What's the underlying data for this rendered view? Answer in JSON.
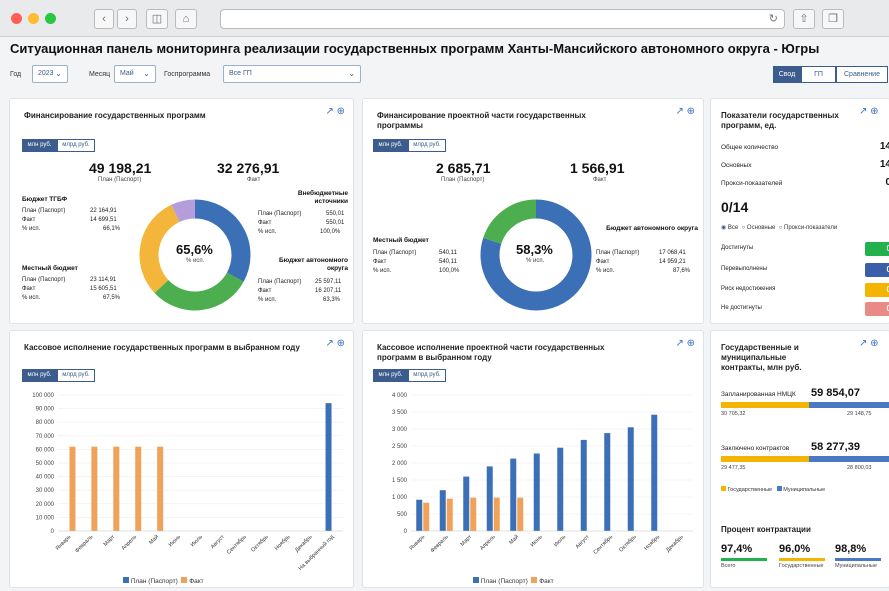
{
  "header": {
    "title": "Ситуационная панель мониторинга реализации государственных программ Ханты-Мансийского автономного округа - Югры"
  },
  "filters": {
    "year_label": "Год",
    "year_value": "2023",
    "month_label": "Месяц",
    "month_value": "Май",
    "program_label": "Госпрограмма",
    "program_value": "Все ГП"
  },
  "view_tabs": [
    "Свод",
    "ГП",
    "Сравнение"
  ],
  "unit_tabs": {
    "mln": "млн руб.",
    "mlrd": "млрд руб."
  },
  "financing": {
    "title": "Финансирование государственных программ",
    "plan_value": "49 198,21",
    "plan_label": "План (Паспорт)",
    "fact_value": "32 276,91",
    "fact_label": "Факт",
    "center_pct": "65,6%",
    "center_sub": "% исп.",
    "blocks": {
      "tgbf": {
        "name": "Бюджет ТГБФ",
        "rows": [
          [
            "План (Паспорт)",
            "22 164,91"
          ],
          [
            "Факт",
            "14 699,51"
          ],
          [
            "% исп.",
            "66,1%"
          ]
        ]
      },
      "local": {
        "name": "Местный бюджет",
        "rows": [
          [
            "План (Паспорт)",
            "23 114,91"
          ],
          [
            "Факт",
            "15 605,51"
          ],
          [
            "% исп.",
            "67,5%"
          ]
        ]
      },
      "offbudget": {
        "name": "Внебюджетные источники",
        "rows": [
          [
            "План (Паспорт)",
            "550,01"
          ],
          [
            "Факт",
            "550,01"
          ],
          [
            "% исп.",
            "100,0%"
          ]
        ]
      },
      "okrug": {
        "name": "Бюджет автономного округа",
        "rows": [
          [
            "План (Паспорт)",
            "25 597,11"
          ],
          [
            "Факт",
            "16 207,11"
          ],
          [
            "% исп.",
            "63,3%"
          ]
        ]
      }
    },
    "donut": [
      {
        "pct": 33.0,
        "color": "#3b6fb6"
      },
      {
        "pct": 30.0,
        "color": "#4cae4f"
      },
      {
        "pct": 30.0,
        "color": "#f3b63a"
      },
      {
        "pct": 7.0,
        "color": "#b39ddb"
      }
    ]
  },
  "project_financing": {
    "title": "Финансирование проектной части государственных программы",
    "plan_value": "2 685,71",
    "plan_label": "План (Паспорт)",
    "fact_value": "1 566,91",
    "fact_label": "Факт",
    "center_pct": "58,3%",
    "center_sub": "% исп.",
    "blocks": {
      "local": {
        "name": "Местный бюджет",
        "rows": [
          [
            "План (Паспорт)",
            "540,11"
          ],
          [
            "Факт",
            "540,11"
          ],
          [
            "% исп.",
            "100,0%"
          ]
        ]
      },
      "okrug": {
        "name": "Бюджет автономного округа",
        "rows": [
          [
            "План (Паспорт)",
            "17 068,41"
          ],
          [
            "Факт",
            "14 959,21"
          ],
          [
            "% исп.",
            "87,6%"
          ]
        ]
      }
    },
    "donut": [
      {
        "pct": 80.0,
        "color": "#3b6fb6"
      },
      {
        "pct": 20.0,
        "color": "#4cae4f"
      }
    ]
  },
  "indicators": {
    "title": "Показатели государственных программ, ед.",
    "rows": [
      [
        "Общее количество",
        "14"
      ],
      [
        "Основных",
        "14"
      ],
      [
        "Прокси-показателей",
        "0"
      ]
    ],
    "ratio": "0/14",
    "radios": [
      "Все",
      "Основные",
      "Прокси-показатели"
    ],
    "statuses": [
      {
        "label": "Достигнуты",
        "value": "0",
        "color": "#22b14c"
      },
      {
        "label": "Перевыполнены",
        "value": "0",
        "color": "#3b5ea8"
      },
      {
        "label": "Риск недостижения",
        "value": "0",
        "color": "#f5b400"
      },
      {
        "label": "Не достигнуты",
        "value": "0",
        "color": "#e98a86"
      }
    ]
  },
  "cash_chart": {
    "title": "Кассовое исполнение государственных программ в выбранном году",
    "legend_plan": "План (Паспорт)",
    "legend_fact": "Факт"
  },
  "project_cash_chart": {
    "title": "Кассовое исполнение проектной части государственных программ в выбранном году",
    "legend_plan": "План (Паспорт)",
    "legend_fact": "Факт"
  },
  "contracts": {
    "title": "Государственные и муниципальные контракты, млн руб.",
    "planned_label": "Запланированная НМЦК",
    "planned_value": "59 854,07",
    "planned_left": "30 705,32",
    "planned_right": "29 148,75",
    "concluded_label": "Заключено контрактов",
    "concluded_value": "58 277,39",
    "concluded_left": "29 477,35",
    "concluded_right": "28 800,03",
    "legend_state": "Государственные",
    "legend_muni": "Муниципальные",
    "pct_title": "Процент контрактации",
    "pcts": [
      [
        "97,4%",
        "Всего",
        "#22b14c"
      ],
      [
        "96,0%",
        "Государственные",
        "#f5b400"
      ],
      [
        "98,8%",
        "Муниципальные",
        "#4a78c2"
      ]
    ]
  },
  "chart_data": [
    {
      "type": "bar",
      "title": "Кассовое исполнение государственных программ в выбранном году",
      "categories": [
        "Январь",
        "Февраль",
        "Март",
        "Апрель",
        "Май",
        "Июнь",
        "Июль",
        "Август",
        "Сентябрь",
        "Октябрь",
        "Ноябрь",
        "Декабрь",
        "На выбранный год"
      ],
      "series": [
        {
          "name": "План (Паспорт)",
          "color": "#3b6fb6",
          "values": [
            0,
            0,
            0,
            0,
            0,
            0,
            0,
            0,
            0,
            0,
            0,
            0,
            94000
          ]
        },
        {
          "name": "Факт",
          "color": "#f0a15a",
          "values": [
            62000,
            62000,
            62000,
            62000,
            62000,
            0,
            0,
            0,
            0,
            0,
            0,
            0,
            0
          ]
        }
      ],
      "yticks": [
        "0",
        "10 000",
        "20 000",
        "30 000",
        "40 000",
        "50 000",
        "60 000",
        "70 000",
        "80 000",
        "90 000",
        "100 000"
      ],
      "ylim": [
        0,
        100000
      ]
    },
    {
      "type": "bar",
      "title": "Кассовое исполнение проектной части государственных программ в выбранном году",
      "categories": [
        "Январь",
        "Февраль",
        "Март",
        "Апрель",
        "Май",
        "Июнь",
        "Июль",
        "Август",
        "Сентябрь",
        "Октябрь",
        "Ноябрь",
        "Декабрь"
      ],
      "series": [
        {
          "name": "План (Паспорт)",
          "color": "#3b6fb6",
          "values": [
            920,
            1200,
            1600,
            1900,
            2130,
            2280,
            2450,
            2680,
            2880,
            3050,
            3420,
            0
          ]
        },
        {
          "name": "Факт",
          "color": "#f0a15a",
          "values": [
            830,
            950,
            980,
            980,
            980,
            0,
            0,
            0,
            0,
            0,
            0,
            0
          ]
        }
      ],
      "yticks": [
        "0",
        "500",
        "1 000",
        "1 500",
        "2 000",
        "2 500",
        "3 000",
        "3 500",
        "4 000"
      ],
      "ylim": [
        0,
        4000
      ]
    }
  ]
}
